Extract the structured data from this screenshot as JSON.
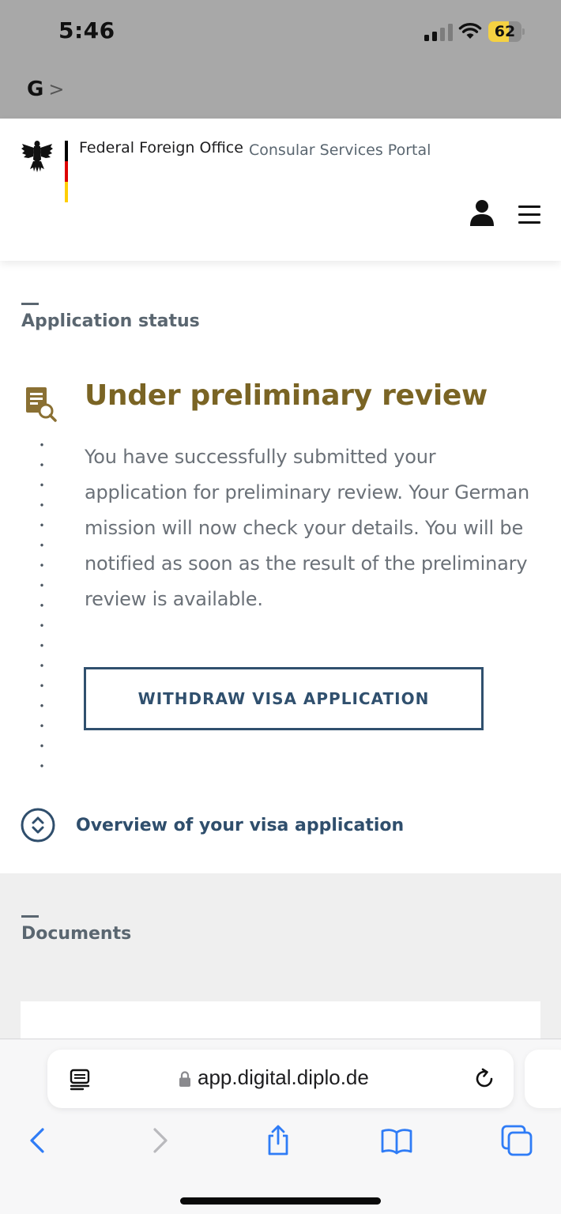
{
  "status_bar": {
    "time": "5:46",
    "battery_level": "62",
    "back_app": "G",
    "back_chevron": ">"
  },
  "header": {
    "organization": "Federal Foreign Office",
    "portal": "Consular Services Portal",
    "icons": [
      "eagle-icon",
      "user-icon",
      "menu-icon"
    ]
  },
  "application_status": {
    "section_title": "Application status",
    "heading": "Under preliminary review",
    "body": "You have successfully submitted your application for preliminary review. Your German mission will now check your details. You will be notified as soon as the result of the preliminary review is available.",
    "withdraw_button": "WITHDRAW VISA APPLICATION",
    "overview_link": "Overview of your visa application"
  },
  "documents": {
    "section_title": "Documents"
  },
  "browser": {
    "url": "app.digital.diplo.de",
    "toolbar_icons": [
      "back-icon",
      "forward-icon",
      "share-icon",
      "bookmarks-icon",
      "tabs-icon"
    ]
  },
  "colors": {
    "status_heading": "#7a6424",
    "brand_blue": "#30506e",
    "flag_black": "#000000",
    "flag_red": "#dd0000",
    "flag_gold": "#ffce00"
  }
}
